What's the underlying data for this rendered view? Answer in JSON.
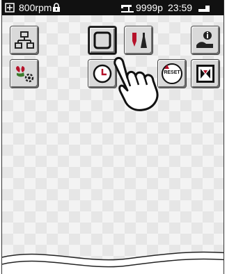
{
  "status_bar": {
    "speed": "800rpm",
    "stitch_count": "9999p",
    "time": "23:59"
  },
  "toolbar": {
    "reset_label": "RESET"
  },
  "icons": {
    "plus_box": "plus-box-icon",
    "lock": "padlock-icon",
    "machine": "sewing-machine-icon",
    "battery": "battery-icon",
    "network": "network-icon",
    "frame": "square-frame-icon",
    "needle": "needle-thread-icon",
    "info": "info-person-icon",
    "flower": "flower-settings-icon",
    "clock": "clock-icon",
    "reset": "reset-icon",
    "embroidery": "embroidery-pattern-icon",
    "hand": "pointing-hand-icon"
  }
}
